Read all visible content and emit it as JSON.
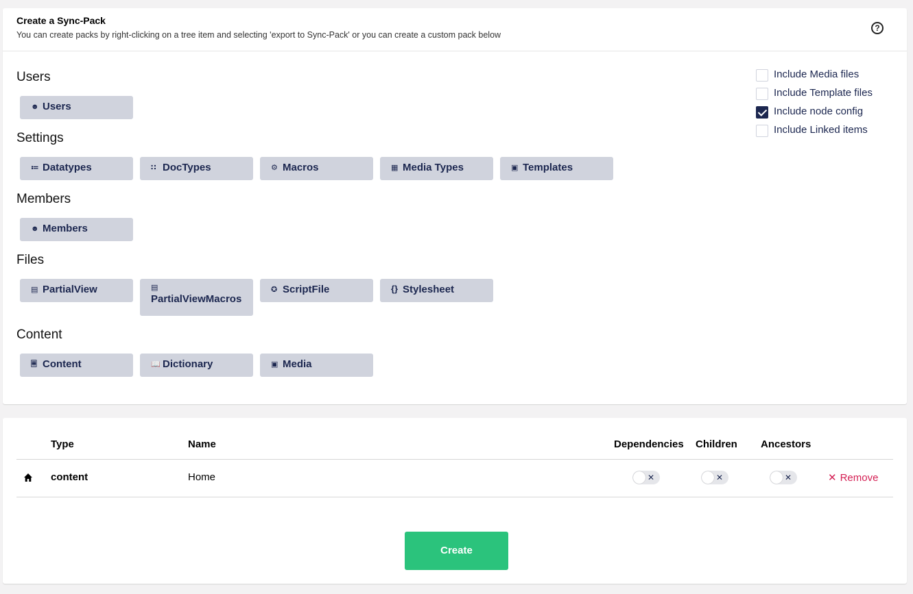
{
  "header": {
    "title": "Create a Sync-Pack",
    "description": "You can create packs by right-clicking on a tree item and selecting 'export to Sync-Pack' or you can create a custom pack below",
    "help_icon": "?"
  },
  "sections": {
    "users": {
      "title": "Users",
      "buttons": [
        {
          "label": "Users",
          "icon": "person-icon"
        }
      ]
    },
    "settings": {
      "title": "Settings",
      "buttons": [
        {
          "label": "Datatypes",
          "icon": "datatype-icon"
        },
        {
          "label": "DocTypes",
          "icon": "grid-icon"
        },
        {
          "label": "Macros",
          "icon": "settings-alt-icon"
        },
        {
          "label": "Media Types",
          "icon": "thumbnails-icon"
        },
        {
          "label": "Templates",
          "icon": "layout-icon"
        }
      ]
    },
    "members": {
      "title": "Members",
      "buttons": [
        {
          "label": "Members",
          "icon": "person-icon"
        }
      ]
    },
    "files": {
      "title": "Files",
      "buttons": [
        {
          "label": "PartialView",
          "icon": "article-icon"
        },
        {
          "label": "PartialViewMacros",
          "icon": "article-icon"
        },
        {
          "label": "ScriptFile",
          "icon": "script-icon"
        },
        {
          "label": "Stylesheet",
          "icon": "brackets-icon"
        }
      ]
    },
    "content": {
      "title": "Content",
      "buttons": [
        {
          "label": "Content",
          "icon": "document-icon"
        },
        {
          "label": "Dictionary",
          "icon": "book-icon"
        },
        {
          "label": "Media",
          "icon": "picture-icon"
        }
      ]
    }
  },
  "options": [
    {
      "label": "Include Media files",
      "checked": false
    },
    {
      "label": "Include Template files",
      "checked": false
    },
    {
      "label": "Include node config",
      "checked": true
    },
    {
      "label": "Include Linked items",
      "checked": false
    }
  ],
  "table": {
    "headers": {
      "type": "Type",
      "name": "Name",
      "dependencies": "Dependencies",
      "children": "Children",
      "ancestors": "Ancestors"
    },
    "rows": [
      {
        "icon": "home-icon",
        "type": "content",
        "name": "Home",
        "dependencies": false,
        "children": false,
        "ancestors": false,
        "remove_label": "Remove"
      }
    ]
  },
  "create_label": "Create",
  "colors": {
    "primary": "#1b264f",
    "button_bg": "#d0d3dd",
    "success": "#2bc37c",
    "danger": "#d42054"
  }
}
